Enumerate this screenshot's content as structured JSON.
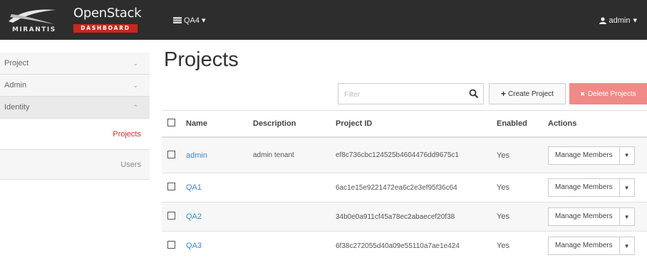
{
  "brand": {
    "company": "MIRANTIS",
    "product": "OpenStack",
    "subtitle": "DASHBOARD",
    "accent": "#c8281e"
  },
  "topbar": {
    "project_selector": {
      "label": "QA4",
      "icon": "server-icon",
      "caret": "▾"
    },
    "user_menu": {
      "label": "admin",
      "icon": "user-icon",
      "caret": "▾"
    },
    "background": "#2d2d2d"
  },
  "sidebar": {
    "sections": [
      {
        "label": "Project",
        "chevron": "⌄"
      },
      {
        "label": "Admin",
        "chevron": "⌄"
      },
      {
        "label": "Identity",
        "chevron": "⌃"
      }
    ],
    "items": [
      {
        "label": "Projects",
        "active": true
      },
      {
        "label": "Users",
        "active": false
      }
    ],
    "active_color": "#d0302a"
  },
  "main": {
    "title": "Projects",
    "filter": {
      "placeholder": "Filter",
      "value": ""
    },
    "create_button": {
      "icon": "+",
      "label": "Create Project"
    },
    "delete_button": {
      "icon": "✖",
      "label": "Delete Projects"
    },
    "table": {
      "columns": [
        "Name",
        "Description",
        "Project ID",
        "Enabled",
        "Actions"
      ],
      "rows": [
        {
          "name": "admin",
          "description": "admin tenant",
          "project_id": "ef8c736cbc124525b4604476dd9675c1",
          "enabled": "Yes",
          "action": "Manage Members"
        },
        {
          "name": "QA1",
          "description": "",
          "project_id": "6ac1e15e9221472ea6c2e3ef95f36c64",
          "enabled": "Yes",
          "action": "Manage Members"
        },
        {
          "name": "QA2",
          "description": "",
          "project_id": "34b0e0a911cf45a78ec2abaecef20f38",
          "enabled": "Yes",
          "action": "Manage Members"
        },
        {
          "name": "QA3",
          "description": "",
          "project_id": "6f38c272055d40a09e55110a7ae1e424",
          "enabled": "Yes",
          "action": "Manage Members"
        }
      ]
    },
    "link_color": "#3a88c8",
    "delete_color": "#ef8a86"
  }
}
